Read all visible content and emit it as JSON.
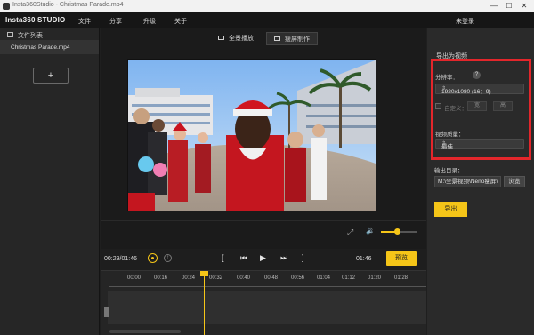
{
  "window": {
    "title": "Insta360Studio - Christmas Parade.mp4",
    "minimize": "—",
    "maximize": "☐",
    "close": "✕"
  },
  "menubar": {
    "brand": "Insta360 STUDIO",
    "items": [
      "文件",
      "分享",
      "升级",
      "关于"
    ],
    "login": "未登录"
  },
  "file_panel": {
    "header": "文件列表",
    "files": [
      "Christmas Parade.mp4"
    ],
    "add_label": "+"
  },
  "view_modes": [
    {
      "label": "全景播放",
      "active": false
    },
    {
      "label": "瘦屏制作",
      "active": true
    }
  ],
  "player": {
    "current_time": "00:29/01:46",
    "total_time": "01:46",
    "preview_label": "预览",
    "volume_level": 0.45,
    "controls": {
      "mark_in": "[",
      "prev": "⏮",
      "play": "▶",
      "next": "⏭",
      "mark_out": "]"
    }
  },
  "timeline": {
    "ticks": [
      "00:00",
      "00:16",
      "00:24",
      "00:32",
      "00:40",
      "00:48",
      "00:56",
      "01:04",
      "01:12",
      "01:20",
      "01:28"
    ],
    "playhead_time": "00:29"
  },
  "export": {
    "title": "导出为视频",
    "resolution_label": "分辨率：",
    "resolution_value": "1920x1080 (16：9)",
    "custom_label": "自定义：",
    "width_value": "宽",
    "height_value": "高",
    "quality_label": "视频质量：",
    "quality_value": "最佳",
    "output_label": "输出目录：",
    "output_path": "M:\\全景视频\\Neno瘦屏\\",
    "browse_label": "浏览",
    "export_label": "导出"
  },
  "colors": {
    "accent": "#f5c518",
    "highlight_box": "#e3262b"
  }
}
